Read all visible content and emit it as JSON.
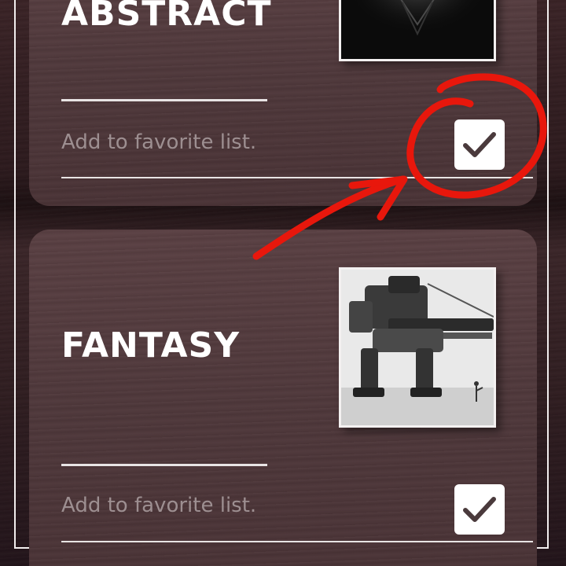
{
  "cards": [
    {
      "title": "ABSTRACT",
      "favorite_label": "Add to favorite list.",
      "favorite_checked": true,
      "thumbnail_icon": "abstract-art-thumbnail"
    },
    {
      "title": "FANTASY",
      "favorite_label": "Add to favorite list.",
      "favorite_checked": true,
      "thumbnail_icon": "mech-robot-thumbnail"
    }
  ],
  "colors": {
    "annotation": "#e8170c",
    "checkmark": "#4a3a3c"
  }
}
